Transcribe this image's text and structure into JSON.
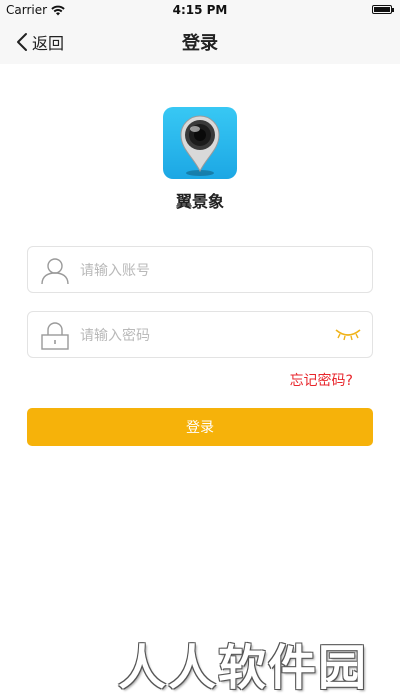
{
  "status_bar": {
    "carrier": "Carrier",
    "time": "4:15 PM"
  },
  "nav": {
    "back_label": "返回",
    "title": "登录"
  },
  "app": {
    "name": "翼景象",
    "logo_icon": "camera-pin-icon"
  },
  "form": {
    "account": {
      "placeholder": "请输入账号",
      "value": "",
      "icon": "user-icon"
    },
    "password": {
      "placeholder": "请输入密码",
      "value": "",
      "icon": "lock-icon",
      "toggle_icon": "closed-eye-icon"
    },
    "forgot_label": "忘记密码?",
    "submit_label": "登录"
  },
  "watermark": {
    "text": "人人软件园"
  },
  "colors": {
    "accent": "#f6b20a",
    "link": "#e8262c",
    "logo_bg": "#2bb9ee"
  }
}
